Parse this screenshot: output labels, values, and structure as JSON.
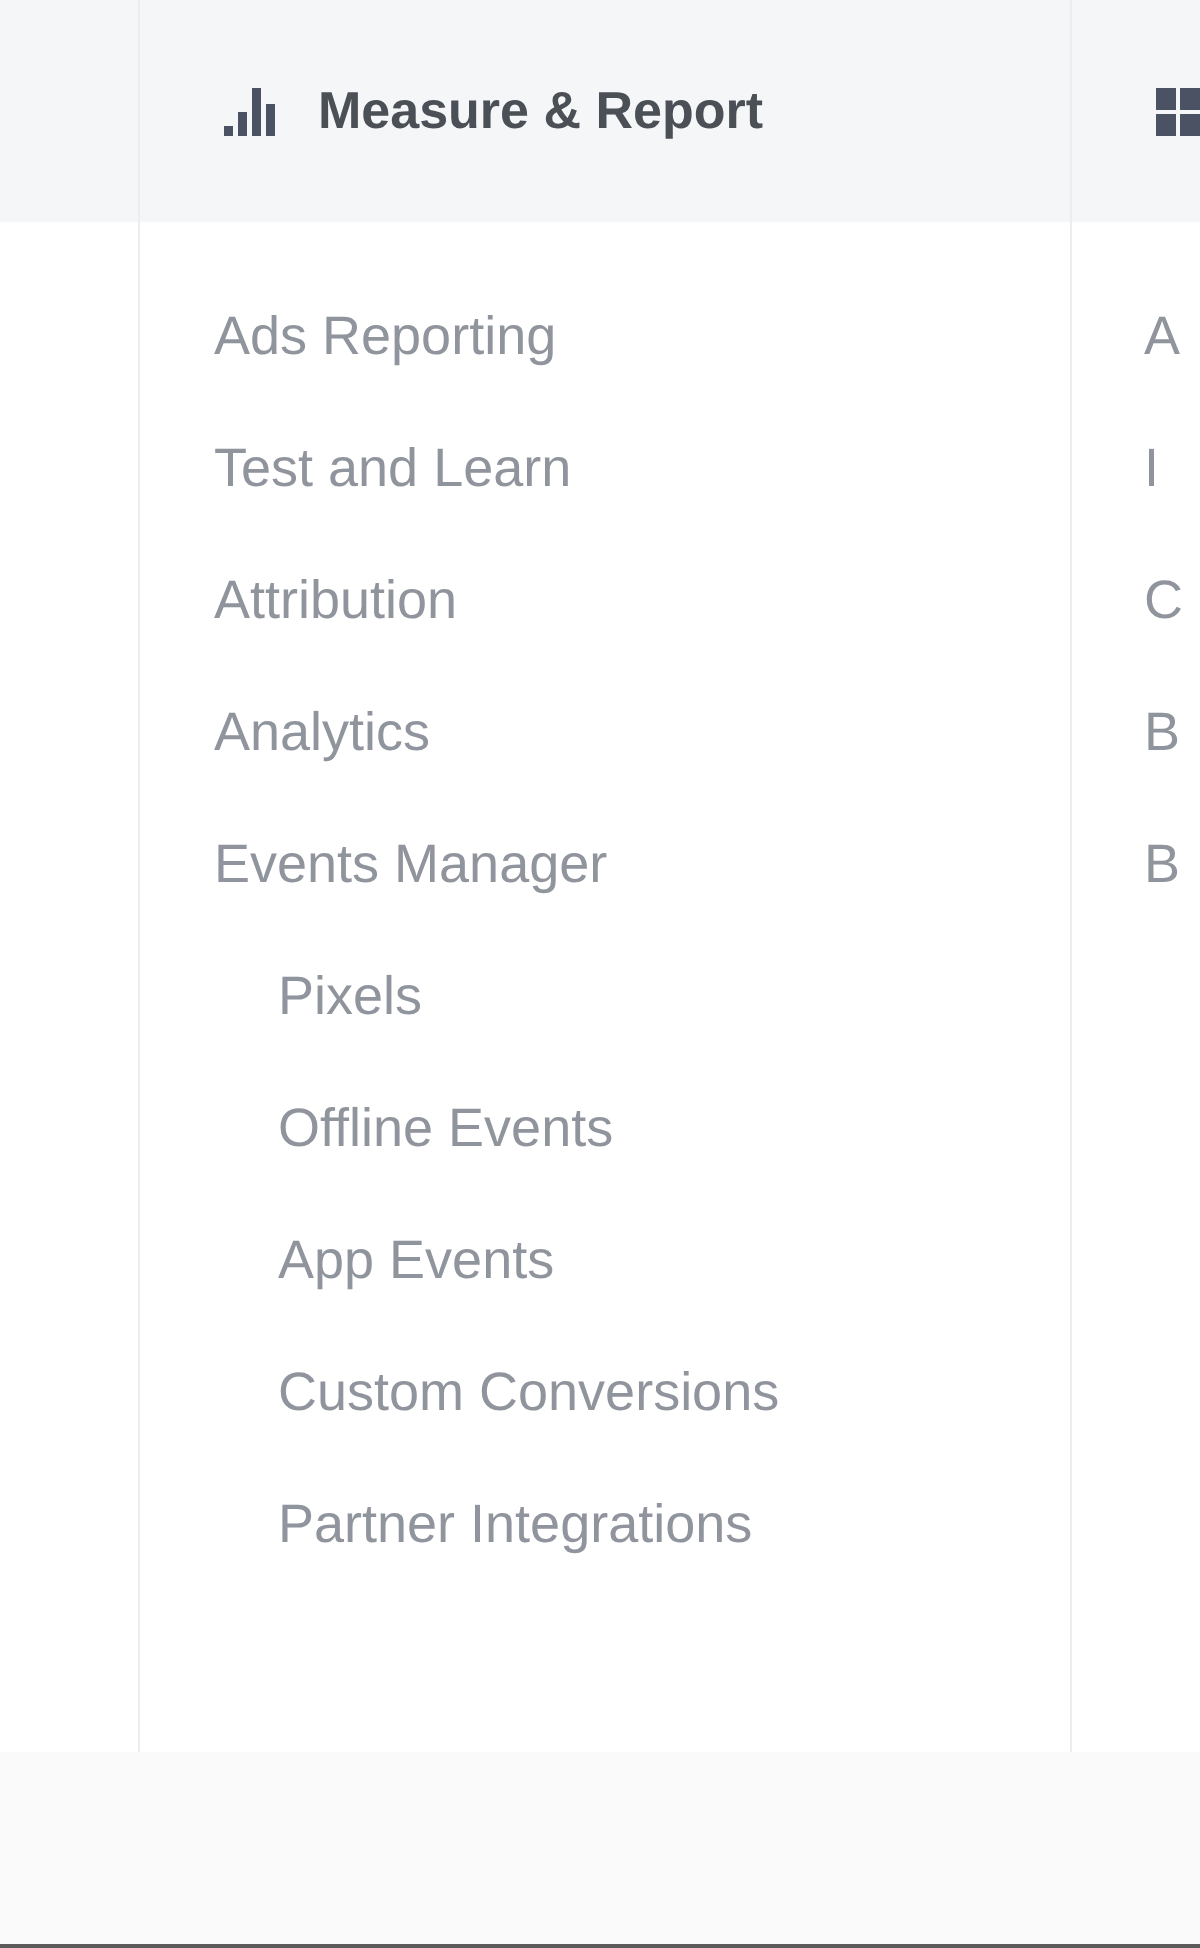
{
  "menu_columns": [
    {
      "title": "Measure & Report",
      "items": [
        {
          "label": "Ads Reporting"
        },
        {
          "label": "Test and Learn"
        },
        {
          "label": "Attribution"
        },
        {
          "label": "Analytics"
        },
        {
          "label": "Events Manager",
          "children": [
            {
              "label": "Pixels"
            },
            {
              "label": "Offline Events"
            },
            {
              "label": "App Events"
            },
            {
              "label": "Custom Conversions"
            },
            {
              "label": "Partner Integrations"
            }
          ]
        }
      ]
    },
    {
      "items": [
        {
          "label": "A"
        },
        {
          "label": "I"
        },
        {
          "label": "C"
        },
        {
          "label": "B"
        },
        {
          "label": "B"
        }
      ]
    }
  ]
}
